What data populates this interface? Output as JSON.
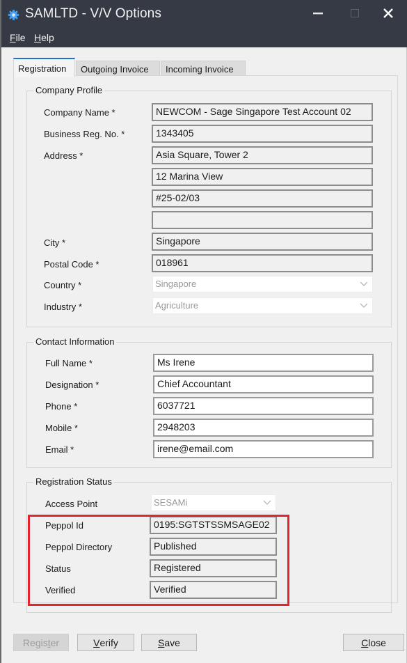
{
  "window": {
    "title": "SAMLTD - V/V Options",
    "icon": "gear-icon",
    "controls": {
      "minimize": "minimize-icon",
      "maximize": "maximize-icon",
      "close": "close-icon"
    }
  },
  "menu": [
    {
      "label_ul": "F",
      "label_rest": "ile"
    },
    {
      "label_ul": "H",
      "label_rest": "elp"
    }
  ],
  "tabs": [
    {
      "label": "Registration",
      "active": true
    },
    {
      "label": "Outgoing Invoice",
      "active": false
    },
    {
      "label": "Incoming Invoice",
      "active": false
    }
  ],
  "company_profile": {
    "title": "Company Profile",
    "company_name": {
      "label": "Company Name *",
      "value": "NEWCOM - Sage Singapore Test Account 02"
    },
    "business_reg_no": {
      "label": "Business Reg. No. *",
      "value": "1343405"
    },
    "address": {
      "label": "Address *",
      "lines": [
        "Asia Square, Tower 2",
        "12 Marina View",
        "#25-02/03",
        ""
      ]
    },
    "city": {
      "label": "City *",
      "value": "Singapore"
    },
    "postal_code": {
      "label": "Postal Code *",
      "value": "018961"
    },
    "country": {
      "label": "Country *",
      "value": "Singapore"
    },
    "industry": {
      "label": "Industry *",
      "value": "Agriculture"
    }
  },
  "contact_information": {
    "title": "Contact Information",
    "full_name": {
      "label": "Full Name *",
      "value": "Ms Irene"
    },
    "designation": {
      "label": "Designation *",
      "value": "Chief Accountant"
    },
    "phone": {
      "label": "Phone *",
      "value": "6037721"
    },
    "mobile": {
      "label": "Mobile *",
      "value": "2948203"
    },
    "email": {
      "label": "Email *",
      "value": "irene@email.com"
    }
  },
  "registration_status": {
    "title": "Registration Status",
    "access_point": {
      "label": "Access Point",
      "value": "SESAMi"
    },
    "peppol_id": {
      "label": "Peppol Id",
      "value": "0195:SGTSTSSMSAGE02"
    },
    "peppol_directory": {
      "label": "Peppol Directory",
      "value": "Published"
    },
    "status": {
      "label": "Status",
      "value": "Registered"
    },
    "verified": {
      "label": "Verified",
      "value": "Verified"
    },
    "highlight_color": "#e1242d"
  },
  "buttons": {
    "register": {
      "pre": "Regis",
      "ul": "t",
      "post": "er",
      "enabled": false
    },
    "verify": {
      "pre": "",
      "ul": "V",
      "post": "erify",
      "enabled": true
    },
    "save": {
      "pre": "",
      "ul": "S",
      "post": "ave",
      "enabled": true
    },
    "close": {
      "pre": "",
      "ul": "C",
      "post": "lose",
      "enabled": true
    }
  },
  "colors": {
    "titlebar": "#363a45",
    "active_tab_accent": "#1f6fd1",
    "app_icon": "#4aa3f0"
  }
}
